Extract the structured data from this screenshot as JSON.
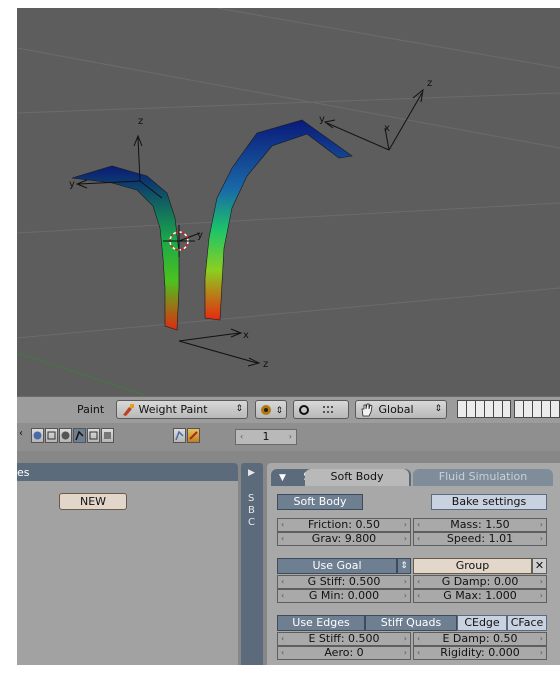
{
  "viewport": {
    "axis_labels": {
      "z": "z",
      "x": "x",
      "y": "y"
    }
  },
  "header": {
    "mode_label": "Paint",
    "mode_value": "Weight Paint",
    "orientation_value": "Global"
  },
  "toolbar": {
    "frame_value": "1"
  },
  "left_panel": {
    "title_fragment": "es",
    "new_label": "NEW"
  },
  "side_tabs": {
    "letters": [
      "S",
      "B",
      "C"
    ]
  },
  "right_panel": {
    "tabs": [
      "Soft Body",
      "Fluid Simulation"
    ],
    "soft_body_toggle": "Soft Body",
    "bake_settings": "Bake settings",
    "friction": "Friction: 0.50",
    "mass": "Mass: 1.50",
    "grav": "Grav: 9.800",
    "speed": "Speed: 1.01",
    "use_goal": "Use Goal",
    "group": "Group",
    "close": "✕",
    "g_stiff": "G Stiff: 0.500",
    "g_damp": "G Damp: 0.00",
    "g_min": "G Min: 0.000",
    "g_max": "G Max: 1.000",
    "use_edges": "Use Edges",
    "stiff_quads": "Stiff Quads",
    "cedge": "CEdge",
    "cface": "CFace",
    "e_stiff": "E Stiff: 0.500",
    "e_damp": "E Damp: 0.50",
    "aero": "Aero: 0",
    "rigidity": "Rigidity: 0.000"
  },
  "colors": {
    "viewport_bg": "#5d5d5d",
    "panel_bg": "#a8a8a8",
    "active_button": "#6f7f92",
    "new_button": "#e1d6c9"
  }
}
